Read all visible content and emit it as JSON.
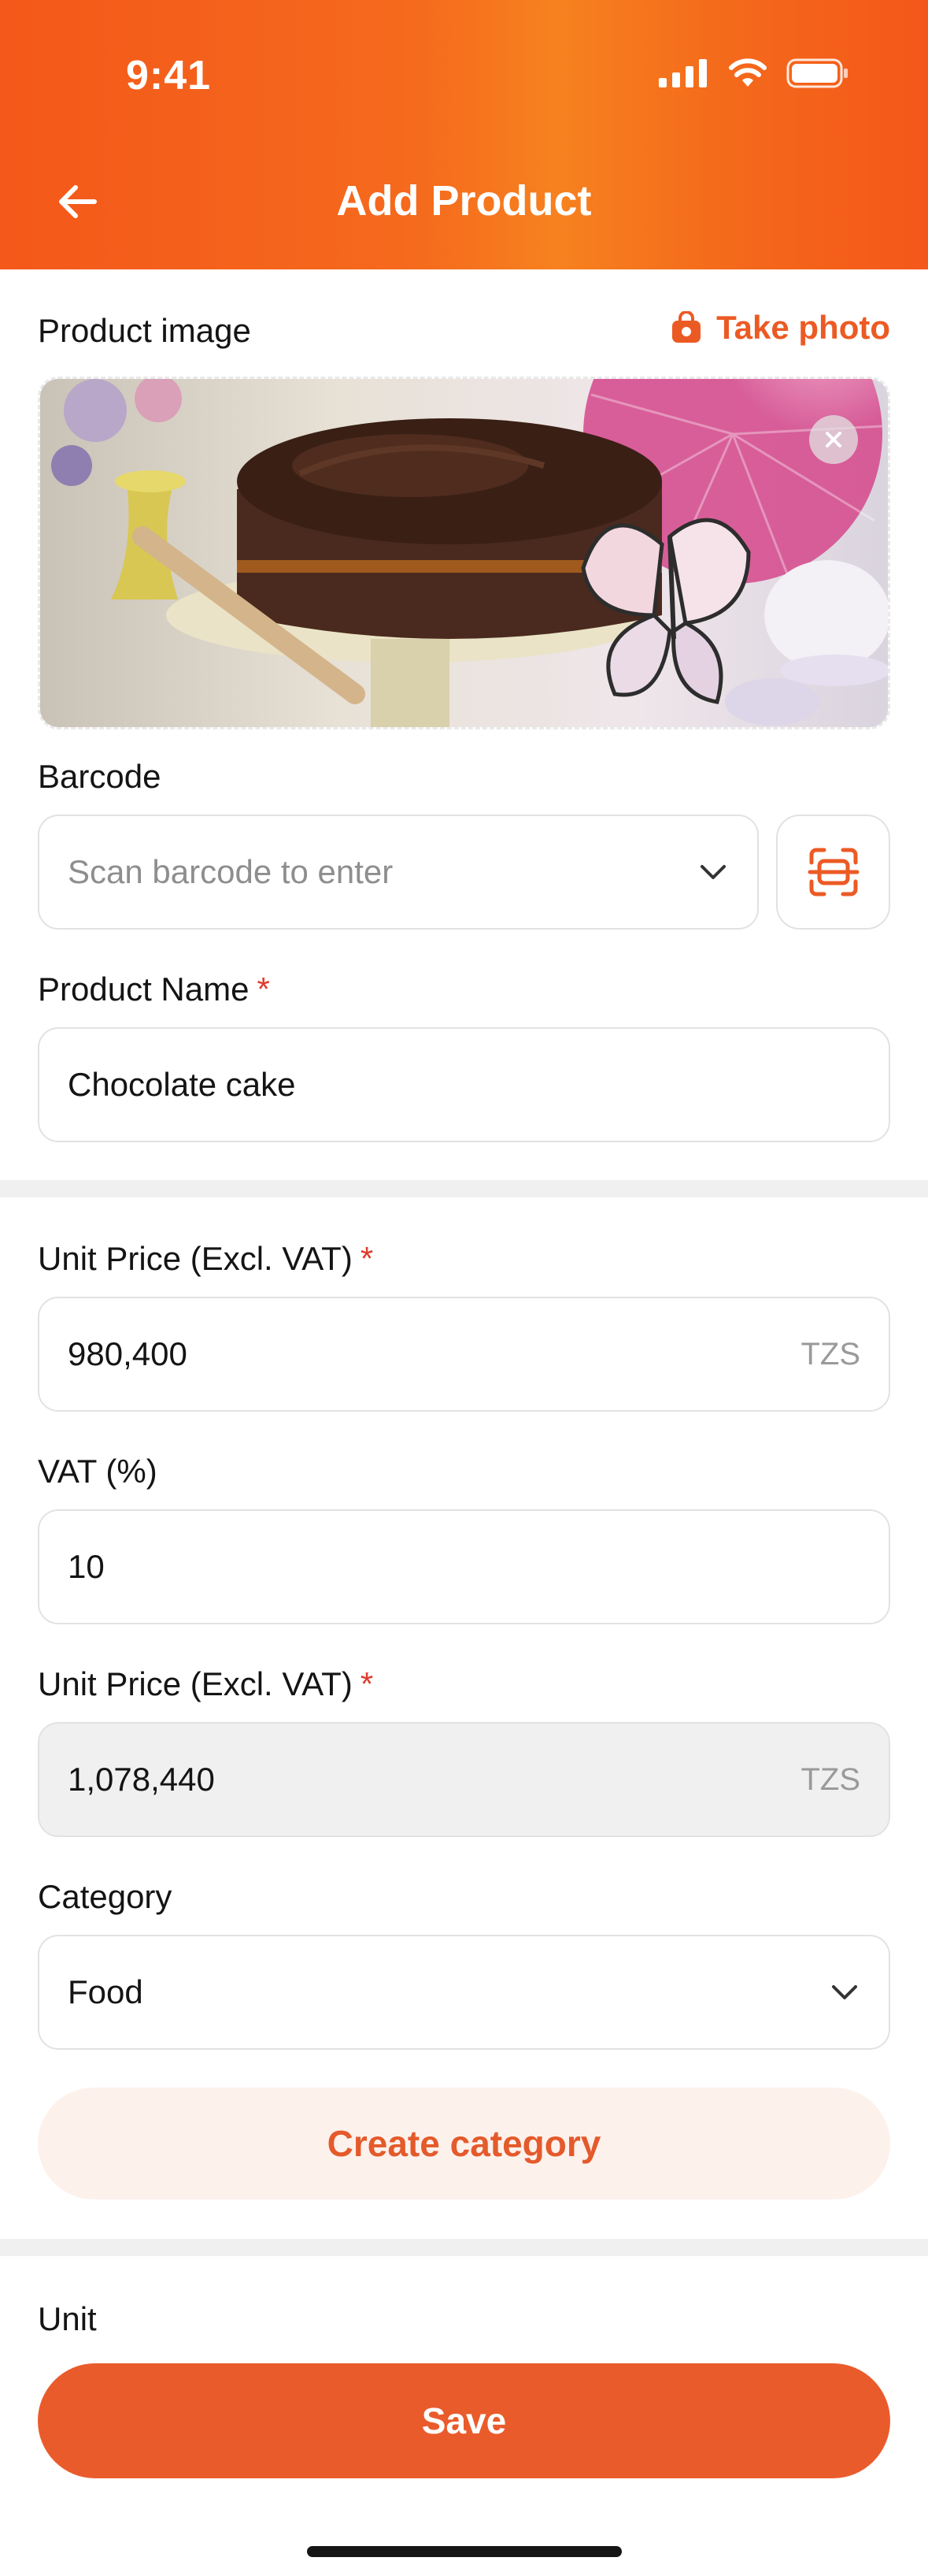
{
  "status_bar": {
    "time": "9:41"
  },
  "header": {
    "title": "Add Product"
  },
  "product_image": {
    "label": "Product image",
    "take_photo_label": "Take photo"
  },
  "barcode": {
    "label": "Barcode",
    "placeholder": "Scan barcode to enter"
  },
  "product_name": {
    "label": "Product Name",
    "required_mark": "*",
    "value": "Chocolate cake"
  },
  "unit_price": {
    "label": "Unit Price (Excl. VAT)",
    "required_mark": "*",
    "value": "980,400",
    "currency": "TZS"
  },
  "vat": {
    "label": "VAT (%)",
    "value": "10"
  },
  "unit_price_total": {
    "label": "Unit Price (Excl. VAT)",
    "required_mark": "*",
    "value": "1,078,440",
    "currency": "TZS"
  },
  "category": {
    "label": "Category",
    "value": "Food",
    "create_label": "Create category"
  },
  "unit": {
    "label": "Unit"
  },
  "footer": {
    "save_label": "Save"
  },
  "colors": {
    "accent": "#ea5b2b",
    "header_gradient_start": "#f4581a",
    "required": "#e03a2c"
  },
  "icons": [
    "arrow-left-icon",
    "signal-icon",
    "wifi-icon",
    "battery-icon",
    "camera-bag-icon",
    "close-icon",
    "chevron-down-icon",
    "scan-barcode-icon"
  ]
}
